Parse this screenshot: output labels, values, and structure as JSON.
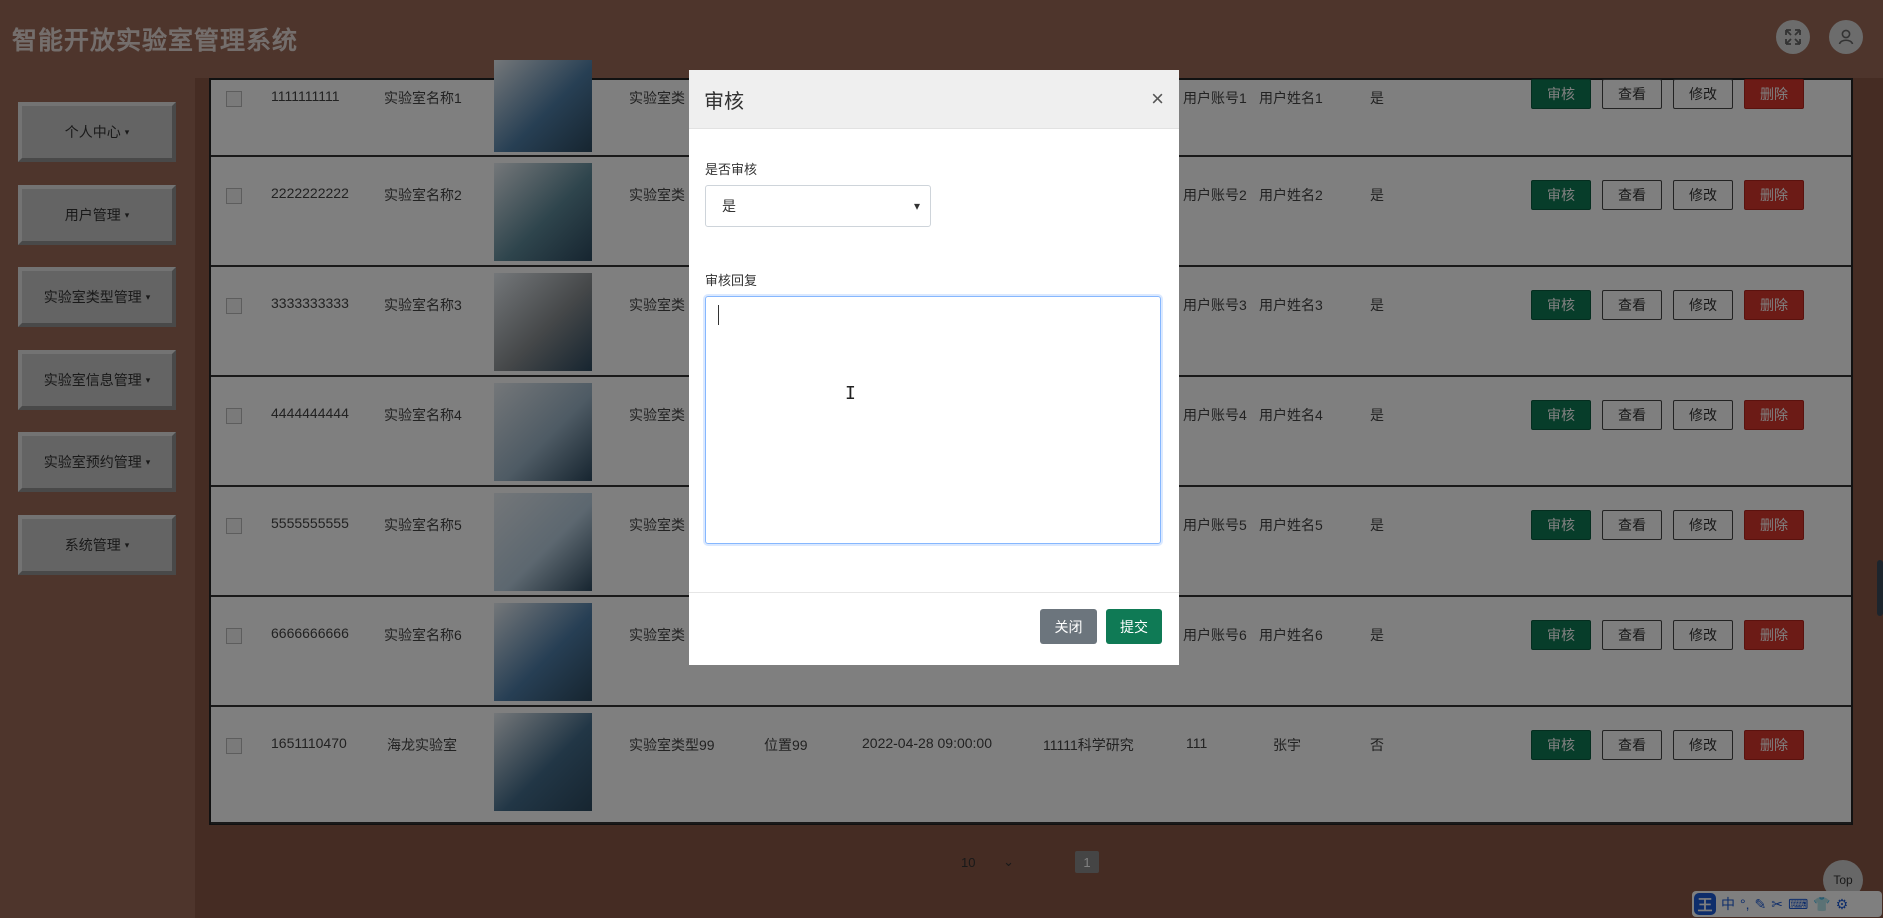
{
  "app": {
    "title": "智能开放实验室管理系统"
  },
  "header": {
    "fullscreen_icon": "fullscreen-icon",
    "user_icon": "user-icon"
  },
  "sidebar": {
    "items": [
      {
        "label": "个人中心"
      },
      {
        "label": "用户管理"
      },
      {
        "label": "实验室类型管理"
      },
      {
        "label": "实验室信息管理"
      },
      {
        "label": "实验室预约管理"
      },
      {
        "label": "系统管理"
      }
    ]
  },
  "table": {
    "rows": [
      {
        "id": "1111111111",
        "name": "实验室名称1",
        "type": "实验室类",
        "location": "",
        "time": "",
        "purpose": "",
        "account": "用户账号1",
        "username": "用户姓名1",
        "approved": "是",
        "thumb_color": "#4f7fa8"
      },
      {
        "id": "2222222222",
        "name": "实验室名称2",
        "type": "实验室类",
        "location": "",
        "time": "",
        "purpose": "",
        "account": "用户账号2",
        "username": "用户姓名2",
        "approved": "是",
        "thumb_color": "#5e8a9a"
      },
      {
        "id": "3333333333",
        "name": "实验室名称3",
        "type": "实验室类",
        "location": "",
        "time": "",
        "purpose": "",
        "account": "用户账号3",
        "username": "用户姓名3",
        "approved": "是",
        "thumb_color": "#8a8f92"
      },
      {
        "id": "4444444444",
        "name": "实验室名称4",
        "type": "实验室类",
        "location": "",
        "time": "",
        "purpose": "",
        "account": "用户账号4",
        "username": "用户姓名4",
        "approved": "是",
        "thumb_color": "#9db6c9"
      },
      {
        "id": "5555555555",
        "name": "实验室名称5",
        "type": "实验室类",
        "location": "",
        "time": "",
        "purpose": "",
        "account": "用户账号5",
        "username": "用户姓名5",
        "approved": "是",
        "thumb_color": "#b9cfe0"
      },
      {
        "id": "6666666666",
        "name": "实验室名称6",
        "type": "实验室类",
        "location": "",
        "time": "",
        "purpose": "",
        "account": "用户账号6",
        "username": "用户姓名6",
        "approved": "是",
        "thumb_color": "#4e7ea9"
      },
      {
        "id": "1651110470",
        "name": "海龙实验室",
        "type": "实验室类型99",
        "location": "位置99",
        "time": "2022-04-28 09:00:00",
        "purpose": "11111科学研究",
        "account": "111",
        "username": "张宇",
        "approved": "否",
        "thumb_color": "#446d8c"
      }
    ],
    "actions": {
      "audit": "审核",
      "view": "查看",
      "edit": "修改",
      "delete": "删除"
    }
  },
  "pagination": {
    "page_size": "10",
    "current_page": "1"
  },
  "modal": {
    "title": "审核",
    "close_symbol": "×",
    "field_audit_label": "是否审核",
    "field_audit_value": "是",
    "field_reply_label": "审核回复",
    "field_reply_value": "",
    "close_button": "关闭",
    "submit_button": "提交"
  },
  "top_button": "Top",
  "ime": {
    "logo": "王",
    "lang": "中"
  }
}
